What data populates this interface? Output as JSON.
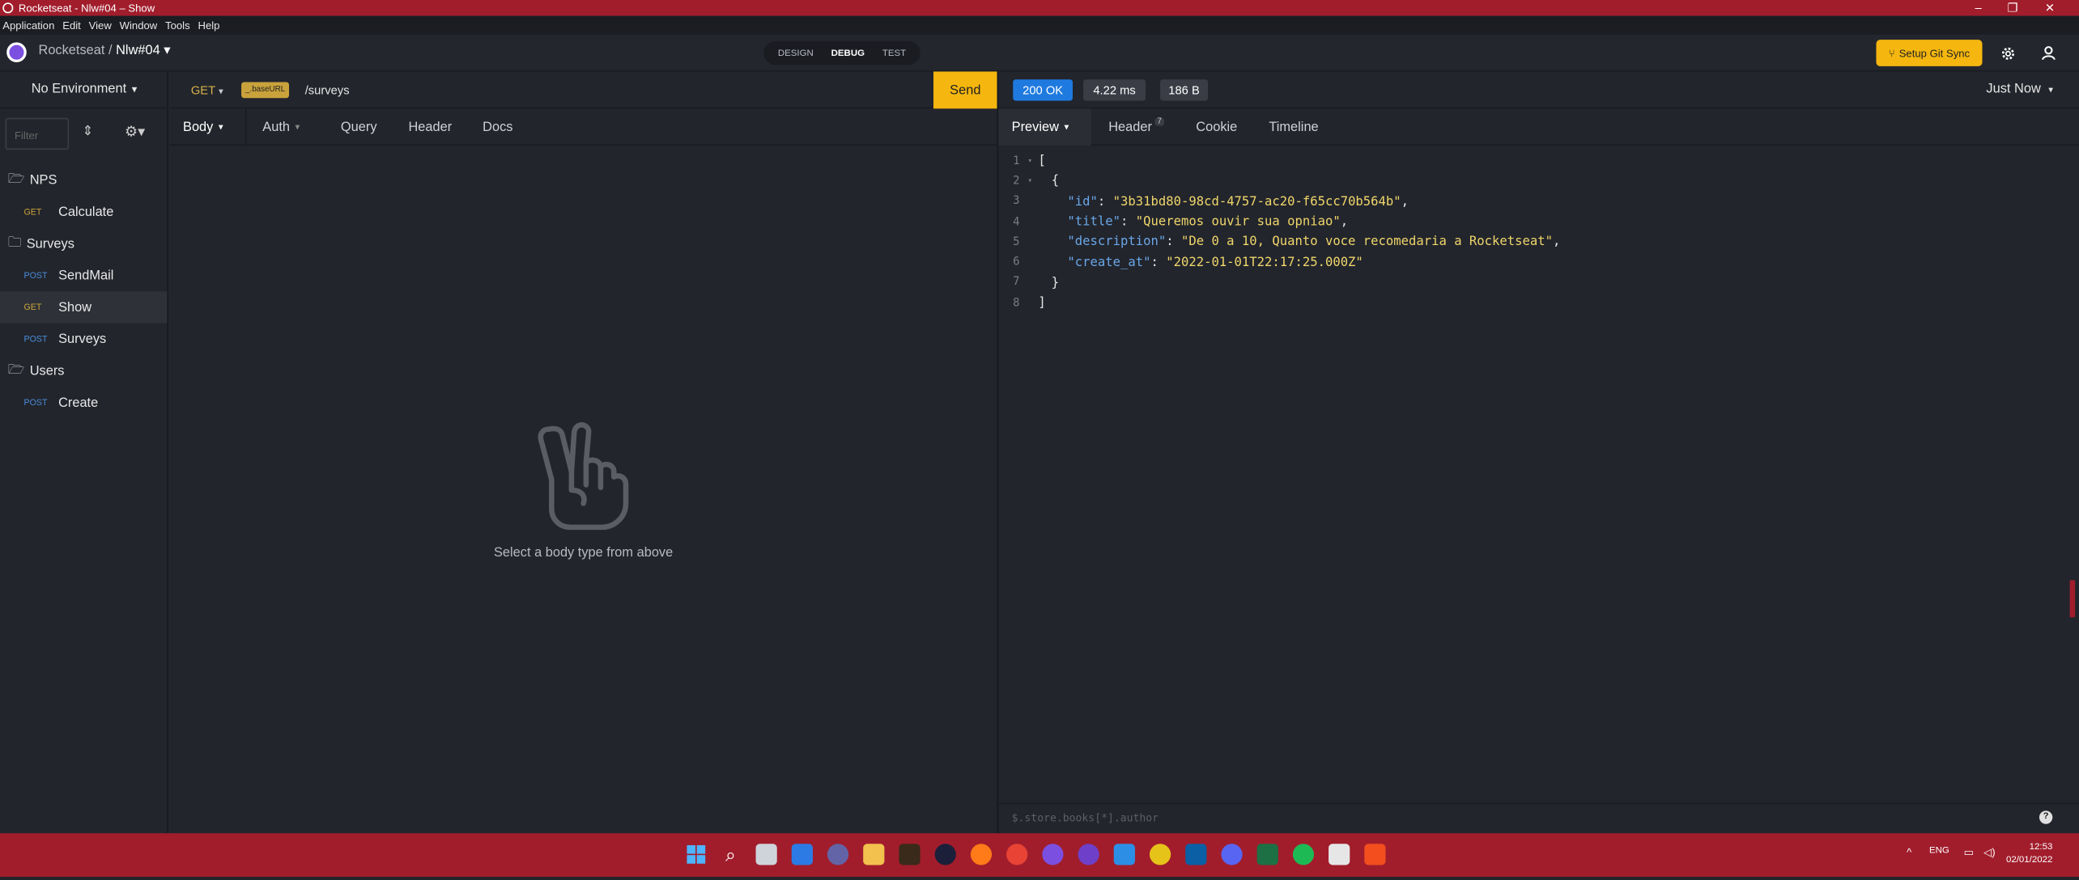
{
  "window": {
    "title": "Rocketseat - Nlw#04 – Show",
    "controls": {
      "minimize": "–",
      "restore": "❐",
      "close": "✕"
    }
  },
  "menu": [
    "Application",
    "Edit",
    "View",
    "Window",
    "Tools",
    "Help"
  ],
  "header": {
    "workspace": "Rocketseat",
    "separator": "/",
    "project": "Nlw#04",
    "project_caret": "▾",
    "modes": [
      "DESIGN",
      "DEBUG",
      "TEST"
    ],
    "active_mode": "DEBUG",
    "git_sync": "Setup Git Sync",
    "git_icon": "⑂"
  },
  "sidebar": {
    "environment": "No Environment",
    "environment_caret": "▾",
    "filter_placeholder": "Filter",
    "sort_glyph": "⇕",
    "add_glyph": "⚙▾",
    "tree": [
      {
        "type": "folder",
        "label": "NPS",
        "icon": "🗁"
      },
      {
        "type": "request",
        "method": "GET",
        "label": "Calculate"
      },
      {
        "type": "folder",
        "label": "Surveys",
        "icon": "🗀"
      },
      {
        "type": "request",
        "method": "POST",
        "label": "SendMail"
      },
      {
        "type": "request",
        "method": "GET",
        "label": "Show",
        "active": true
      },
      {
        "type": "request",
        "method": "POST",
        "label": "Surveys"
      },
      {
        "type": "folder",
        "label": "Users",
        "icon": "🗁"
      },
      {
        "type": "request",
        "method": "POST",
        "label": "Create"
      }
    ]
  },
  "request": {
    "method": "GET",
    "method_caret": "▾",
    "env_var": "_.baseURL",
    "path": "/surveys",
    "send": "Send",
    "tabs": [
      "Body",
      "Auth",
      "Query",
      "Header",
      "Docs"
    ],
    "tab_caret": "▾",
    "empty_message": "Select a body type from above"
  },
  "response": {
    "status": "200 OK",
    "status_color": "#1f7ae0",
    "time": "4.22 ms",
    "size": "186 B",
    "history": "Just Now",
    "history_caret": "▾",
    "tabs": [
      "Preview",
      "Header",
      "Cookie",
      "Timeline"
    ],
    "tab_caret": "▾",
    "header_count": "7",
    "filter_placeholder": "$.store.books[*].author",
    "help_glyph": "?",
    "body": {
      "id": "3b31bd80-98cd-4757-ac20-f65cc70b564b",
      "title": "Queremos ouvir sua opniao",
      "description": "De 0 a 10, Quanto voce recomedaria a Rocketseat",
      "create_at": "2022-01-01T22:17:25.000Z"
    },
    "line_numbers": [
      "1",
      "2",
      "3",
      "4",
      "5",
      "6",
      "7",
      "8"
    ],
    "fold_glyph": "▾",
    "keys": {
      "id": "\"id\"",
      "title": "\"title\"",
      "description": "\"description\"",
      "create_at": "\"create_at\""
    },
    "values": {
      "id": "\"3b31bd80-98cd-4757-ac20-f65cc70b564b\"",
      "title": "\"Queremos ouvir sua opniao\"",
      "description": "\"De 0 a 10, Quanto voce recomedaria a Rocketseat\"",
      "create_at": "\"2022-01-01T22:17:25.000Z\""
    },
    "punct": {
      "open_arr": "[",
      "open_obj": "{",
      "colon": ": ",
      "comma": ",",
      "close_obj": "}",
      "close_arr": "]"
    }
  },
  "taskbar": {
    "icons": [
      "windows-start-icon",
      "search-icon",
      "task-view-icon",
      "widgets-icon",
      "teams-chat-icon",
      "file-explorer-icon",
      "app-icon",
      "app-icon",
      "firefox-icon",
      "chrome-icon",
      "insomnia-icon",
      "github-icon",
      "vscode-icon",
      "app-icon",
      "terminal-icon",
      "discord-icon",
      "excel-icon",
      "spotify-icon",
      "app-icon",
      "figma-icon"
    ],
    "glyphs": {
      "search-icon": "⌕"
    },
    "tray_caret": "^",
    "language": "ENG",
    "time": "12:53",
    "date": "02/01/2022"
  },
  "colors": {
    "accent": "#f5b70f",
    "titlebar": "#a11d2c",
    "get": "#c9a23b",
    "post": "#4a8ddb"
  }
}
